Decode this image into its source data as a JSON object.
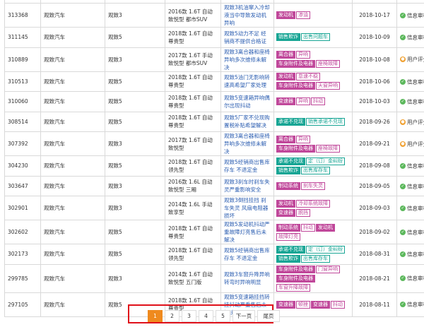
{
  "rows": [
    {
      "id": "",
      "brand": "",
      "series": "",
      "model": "",
      "title": "",
      "tags": [],
      "date": "",
      "status": "",
      "status_kind": "none"
    },
    {
      "id": "313368",
      "brand": "观致汽车",
      "series": "观致3",
      "model": "2016款 1.6T 自动 致悦型 都市SUV",
      "title": "观致3机油窜入冷却液当中导致发动机异响",
      "tags": [
        {
          "text": "发动机",
          "style": "pink"
        },
        {
          "text": "渗油",
          "style": "pink-o"
        }
      ],
      "date": "2018-10-17",
      "status": "信息审核",
      "status_kind": "ok"
    },
    {
      "id": "311145",
      "brand": "观致汽车",
      "series": "观致5",
      "model": "2018款 1.6T 自动 尊贵型",
      "title": "观致5动力不足 经销商不提供合格证",
      "tags": [
        {
          "text": "销售欺诈",
          "style": "teal"
        },
        {
          "text": "出售问题车",
          "style": "teal-o"
        }
      ],
      "date": "2018-10-09",
      "status": "信息审核",
      "status_kind": "ok"
    },
    {
      "id": "310889",
      "brand": "观致汽车",
      "series": "观致3",
      "model": "2017款 1.6T 手动 致悦型 都市SUV",
      "title": "观致3离合器和座椅异响多次维修未解决",
      "tags": [
        {
          "text": "离合器",
          "style": "pink"
        },
        {
          "text": "异响",
          "style": "pink-o"
        },
        {
          "text": "车身附件及电器",
          "style": "pink"
        },
        {
          "text": "座椅故障",
          "style": "pink-o"
        }
      ],
      "date": "2018-10-08",
      "status": "用户评分",
      "status_kind": "user"
    },
    {
      "id": "310513",
      "brand": "观致汽车",
      "series": "观致5",
      "model": "2018款 1.6T 自动 尊贵型",
      "title": "观致5油门无影响转速高希望厂家处理",
      "tags": [
        {
          "text": "发动机",
          "style": "pink"
        },
        {
          "text": "怠速不稳",
          "style": "pink-o"
        },
        {
          "text": "车身附件及电器",
          "style": "pink"
        },
        {
          "text": "天窗异响",
          "style": "pink-o"
        }
      ],
      "date": "2018-10-06",
      "status": "信息审核",
      "status_kind": "ok"
    },
    {
      "id": "310060",
      "brand": "观致汽车",
      "series": "观致5",
      "model": "2018款 1.6T 自动 尊贵型",
      "title": "观致5变速箱异响偶尔出现抖动",
      "tags": [
        {
          "text": "变速器",
          "style": "pink"
        },
        {
          "text": "异响",
          "style": "pink-o"
        },
        {
          "text": "抖动",
          "style": "pink-o"
        }
      ],
      "date": "2018-10-03",
      "status": "信息审核",
      "status_kind": "ok"
    },
    {
      "id": "308514",
      "brand": "观致汽车",
      "series": "观致5",
      "model": "2018款 1.6T 自动 尊贵型",
      "title": "观致5厂家不兑现购置税补贴希望解决",
      "tags": [
        {
          "text": "承诺不兑现",
          "style": "teal"
        },
        {
          "text": "销售承诺不兑现",
          "style": "teal-o"
        }
      ],
      "date": "2018-09-26",
      "status": "用户评分",
      "status_kind": "user"
    },
    {
      "id": "307392",
      "brand": "观致汽车",
      "series": "观致3",
      "model": "2017款 1.6T 自动 致悦型",
      "title": "观致3离合器和座椅异响多次维修未解决",
      "tags": [
        {
          "text": "离合器",
          "style": "pink"
        },
        {
          "text": "异响",
          "style": "pink-o"
        },
        {
          "text": "车身附件及电器",
          "style": "pink"
        },
        {
          "text": "座椅故障",
          "style": "pink-o"
        }
      ],
      "date": "2018-09-21",
      "status": "用户评分",
      "status_kind": "user"
    },
    {
      "id": "304230",
      "brand": "观致汽车",
      "series": "观致5",
      "model": "2018款 1.6T 自动 领先型",
      "title": "观致5经销商出售库存车 不退定金",
      "tags": [
        {
          "text": "承诺不兑现",
          "style": "teal"
        },
        {
          "text": "定（订）金纠纷",
          "style": "teal-o"
        },
        {
          "text": "销售欺诈",
          "style": "teal"
        },
        {
          "text": "出售库存车",
          "style": "teal-o"
        }
      ],
      "date": "2018-09-08",
      "status": "信息审核",
      "status_kind": "ok"
    },
    {
      "id": "303647",
      "brand": "观致汽车",
      "series": "观致3",
      "model": "2016款 1.6L 自动 致悦型 三厢",
      "title": "观致3刹车时刹车失灵严重影响安全",
      "tags": [
        {
          "text": "制动系统",
          "style": "pink"
        },
        {
          "text": "刹车失灵",
          "style": "pink-o"
        }
      ],
      "date": "2018-09-05",
      "status": "信息审核",
      "status_kind": "ok"
    },
    {
      "id": "302901",
      "brand": "观致汽车",
      "series": "观致3",
      "model": "2014款 1.6L 手动 致享型",
      "title": "观致3倒挡挂挡 刹车失灵 风扇电阻器损坏",
      "tags": [
        {
          "text": "发动机",
          "style": "pink"
        },
        {
          "text": "冷却系统故障",
          "style": "pink-o"
        },
        {
          "text": "变速器",
          "style": "pink"
        },
        {
          "text": "脱挡",
          "style": "pink-o"
        }
      ],
      "date": "2018-09-03",
      "status": "信息审核",
      "status_kind": "ok"
    },
    {
      "id": "302602",
      "brand": "观致汽车",
      "series": "观致5",
      "model": "2018款 1.6T 自动 尊贵型",
      "title": "观致5发动机抖动严重故障灯亮售后未解决",
      "tags": [
        {
          "text": "制动系统",
          "style": "pink"
        },
        {
          "text": "抖动",
          "style": "pink-o"
        },
        {
          "text": "发动机",
          "style": "pink"
        },
        {
          "text": "故障灯亮",
          "style": "pink-o"
        }
      ],
      "date": "2018-09-02",
      "status": "信息审核",
      "status_kind": "ok"
    },
    {
      "id": "302173",
      "brand": "观致汽车",
      "series": "观致5",
      "model": "2018款 1.6T 自动 领先型",
      "title": "观致5经销商出售库存车 不退定金",
      "tags": [
        {
          "text": "承诺不兑现",
          "style": "teal"
        },
        {
          "text": "定（订）金纠纷",
          "style": "teal-o"
        },
        {
          "text": "销售欺诈",
          "style": "teal"
        },
        {
          "text": "出售库存车",
          "style": "teal-o"
        }
      ],
      "date": "2018-08-31",
      "status": "信息审核",
      "status_kind": "ok"
    },
    {
      "id": "299785",
      "brand": "观致汽车",
      "series": "观致3",
      "model": "2014款 1.6T 自动 致悦型 五门版",
      "title": "观致3车窗升降异响 转弯时异响明显",
      "tags": [
        {
          "text": "车身附件及电器",
          "style": "pink"
        },
        {
          "text": "门窗异响",
          "style": "pink-o"
        },
        {
          "text": "车身附件及电器",
          "style": "pink"
        },
        {
          "text": "车窗升降故障",
          "style": "pink-o"
        }
      ],
      "date": "2018-08-21",
      "status": "信息审核",
      "status_kind": "ok"
    },
    {
      "id": "297105",
      "brand": "观致汽车",
      "series": "观致5",
      "model": "2018款 1.6T 自动 尊贵型",
      "title": "观致5变速箱挂挡转挂抖动严重售后未解决",
      "tags": [
        {
          "text": "变速器",
          "style": "pink"
        },
        {
          "text": "顿挫",
          "style": "pink-o"
        },
        {
          "text": "变速器",
          "style": "pink"
        },
        {
          "text": "抖动",
          "style": "pink-o"
        }
      ],
      "date": "2018-08-11",
      "status": "信息审核",
      "status_kind": "ok"
    }
  ],
  "pager": {
    "pages": [
      "1",
      "2",
      "3",
      "4",
      "5"
    ],
    "active": "1",
    "next_label": "下一页",
    "last_label": "尾页"
  },
  "colors": {
    "accent": "#ef8a1e",
    "tag_pink": "#c0479a",
    "tag_teal": "#17a594",
    "highlight": "#e0101a"
  }
}
